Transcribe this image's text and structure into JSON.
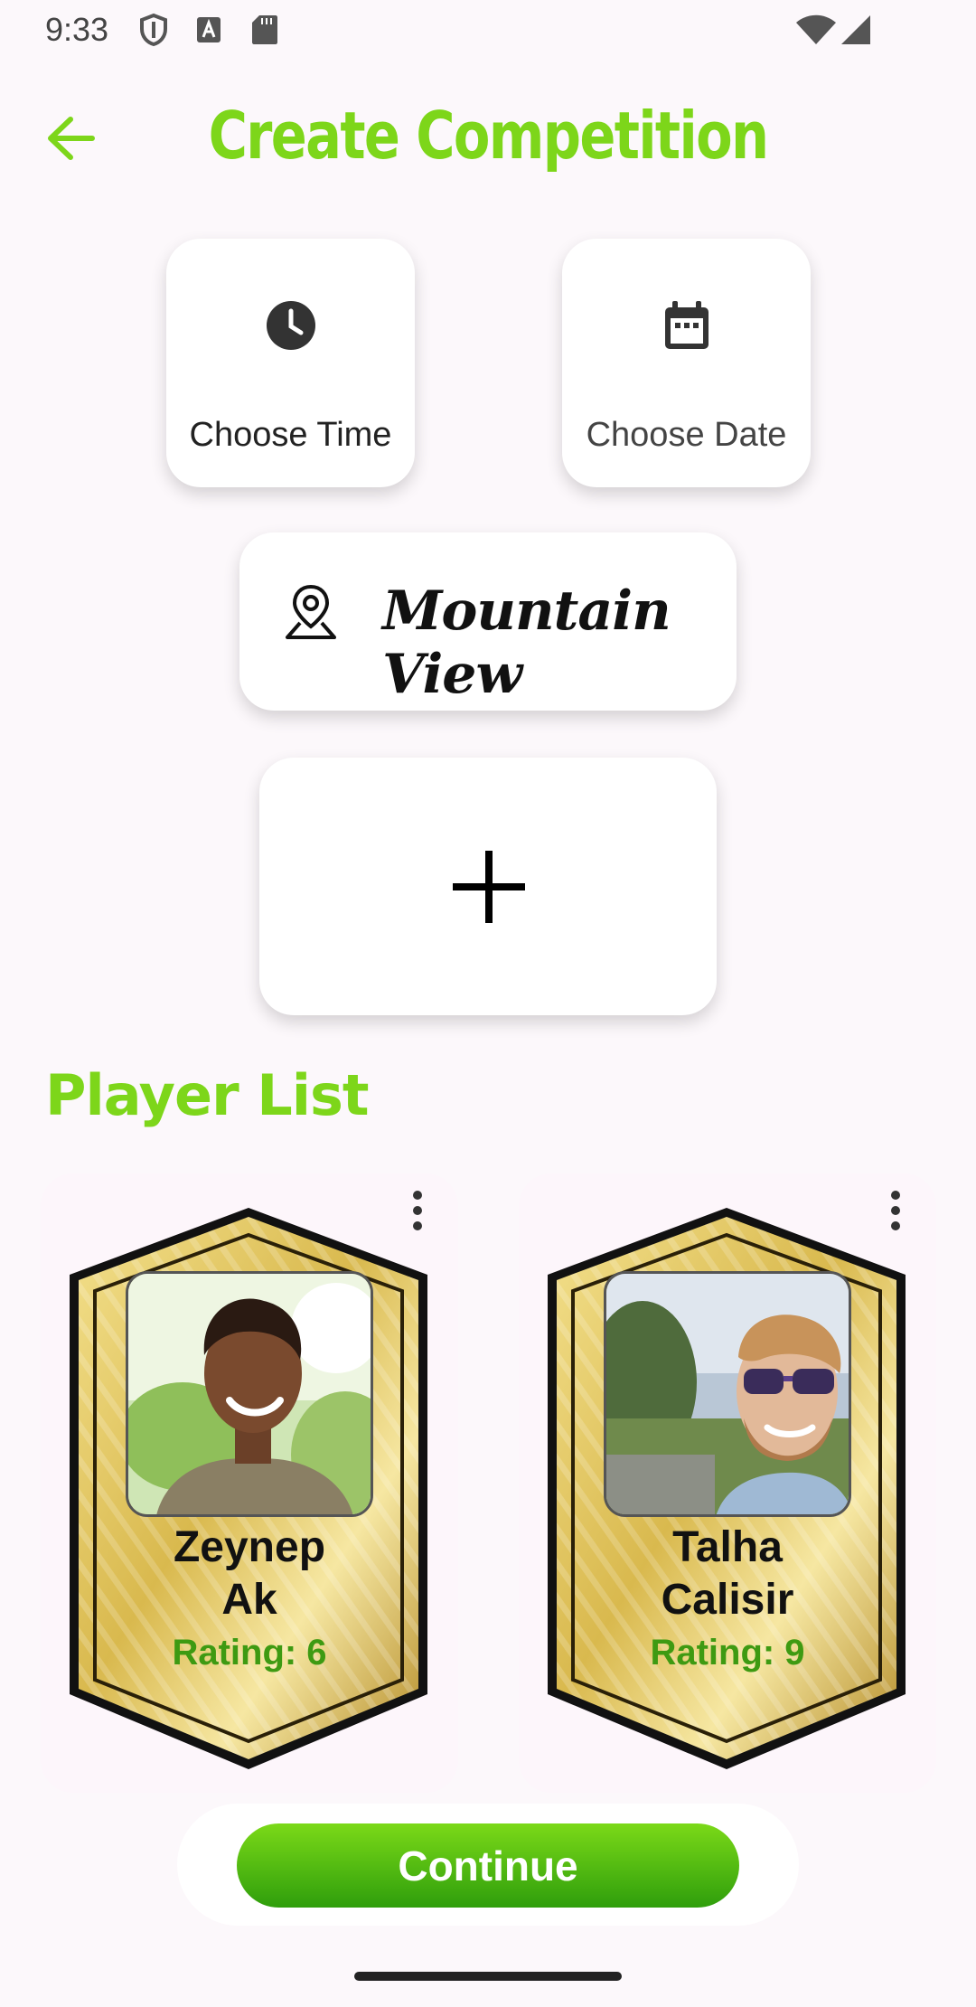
{
  "status_bar": {
    "time": "9:33"
  },
  "header": {
    "title": "Create Competition",
    "back_icon": "arrow-back-icon"
  },
  "schedule": {
    "time_label": "Choose Time",
    "date_label": "Choose Date"
  },
  "location": {
    "name": "Mountain View"
  },
  "player_list": {
    "title": "Player List",
    "players": [
      {
        "name_line1": "Zeynep",
        "name_line2": "Ak",
        "rating": "Rating: 6"
      },
      {
        "name_line1": "Talha",
        "name_line2": "Calisir",
        "rating": "Rating: 9"
      }
    ]
  },
  "footer": {
    "continue_label": "Continue"
  },
  "colors": {
    "accent_green": "#7dd61a",
    "rating_green": "#3e9a12",
    "gold": "#d8b548"
  }
}
